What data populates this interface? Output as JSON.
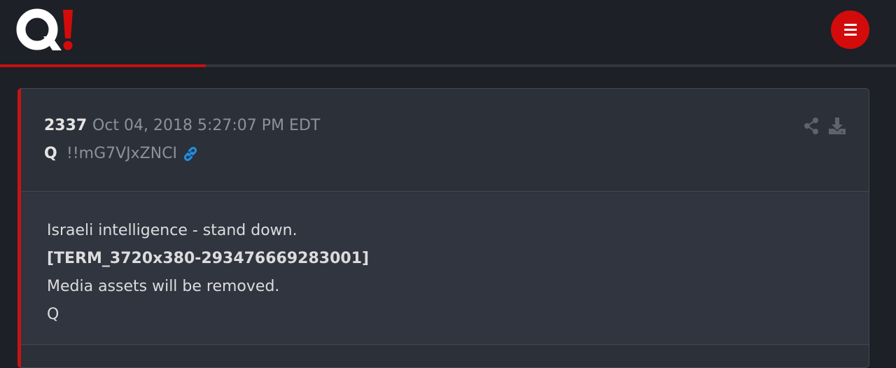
{
  "header": {
    "logo_text": "Q!",
    "menu_icon": "hamburger-icon",
    "progress_fraction": 0.23,
    "accent_color": "#d40b0b"
  },
  "post": {
    "number": "2337",
    "timestamp": "Oct 04, 2018 5:27:07 PM EDT",
    "author": "Q",
    "tripcode": "!!mG7VJxZNCI",
    "icons": [
      "link-icon",
      "share-icon",
      "download-icon"
    ],
    "lines": [
      "Israeli intelligence - stand down.",
      "[TERM_3720x380-293476669283001]",
      "Media assets will be removed.",
      "Q"
    ]
  }
}
